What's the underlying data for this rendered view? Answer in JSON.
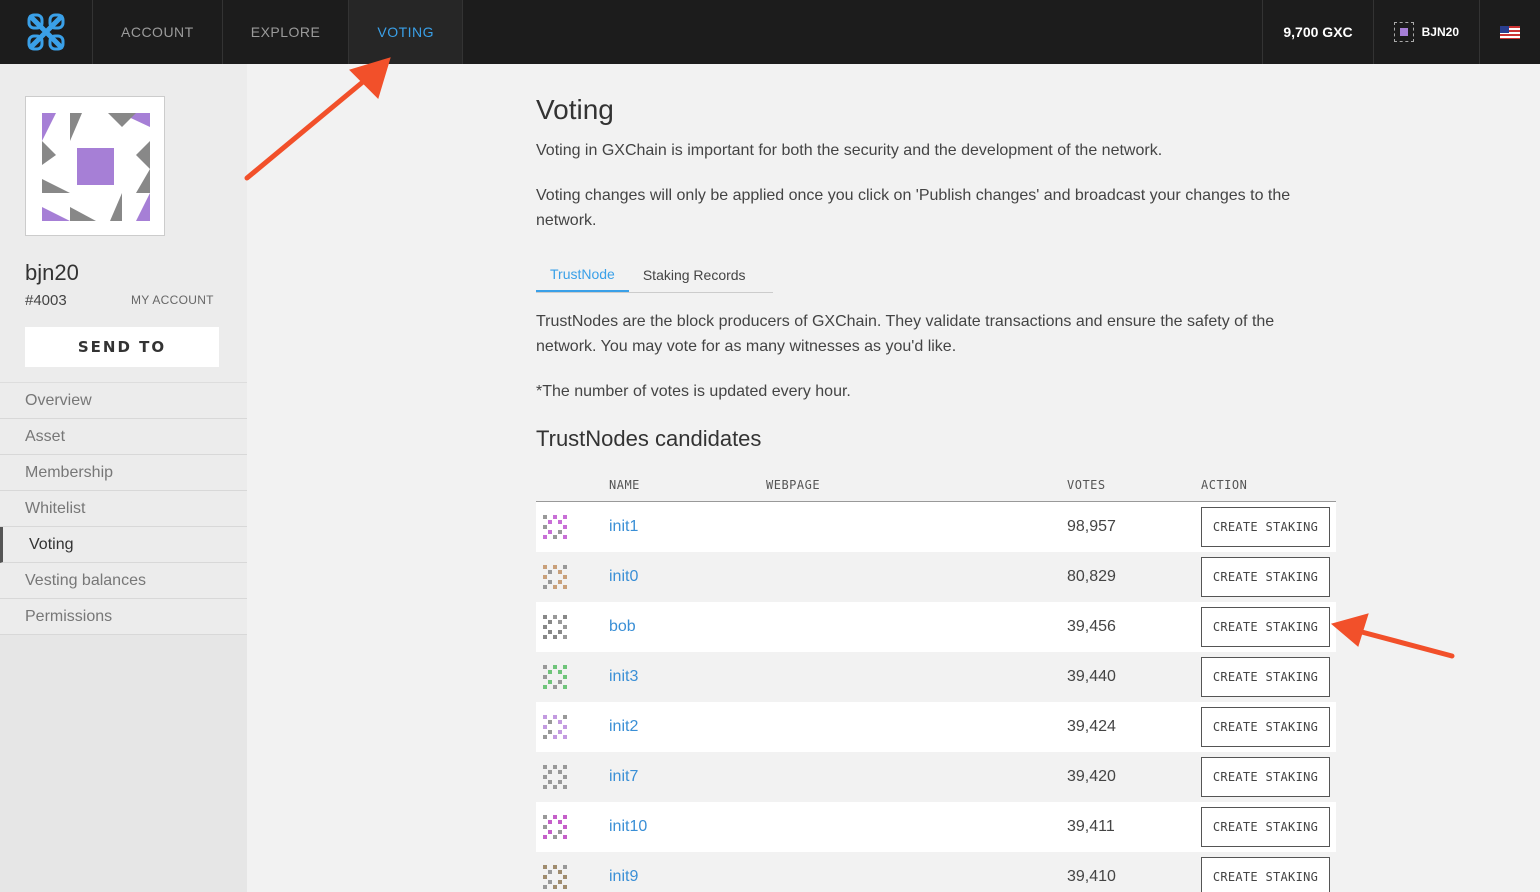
{
  "topbar": {
    "logo_icon": "gxchain-logo-icon",
    "nav": [
      {
        "label": "ACCOUNT",
        "active": false
      },
      {
        "label": "EXPLORE",
        "active": false
      },
      {
        "label": "VOTING",
        "active": true
      }
    ],
    "balance": "9,700 GXC",
    "account": "BJN20",
    "language_icon": "us-flag-icon"
  },
  "sidebar": {
    "account_name": "bjn20",
    "account_id": "#4003",
    "my_account_label": "MY ACCOUNT",
    "send_to_label": "SEND TO",
    "menu": [
      {
        "label": "Overview",
        "active": false
      },
      {
        "label": "Asset",
        "active": false
      },
      {
        "label": "Membership",
        "active": false
      },
      {
        "label": "Whitelist",
        "active": false
      },
      {
        "label": "Voting",
        "active": true
      },
      {
        "label": "Vesting balances",
        "active": false
      },
      {
        "label": "Permissions",
        "active": false
      }
    ]
  },
  "main": {
    "title": "Voting",
    "intro1": "Voting in GXChain is important for both the security and the development of the network.",
    "intro2": "Voting changes will only be applied once you click on 'Publish changes' and broadcast your changes to the network.",
    "tabs": [
      {
        "label": "TrustNode",
        "active": true
      },
      {
        "label": "Staking Records",
        "active": false
      }
    ],
    "desc1": "TrustNodes are the block producers of GXChain. They validate transactions and ensure the safety of the network. You may vote for as many witnesses as you'd like.",
    "desc2": "*The number of votes is updated every hour.",
    "section_title": "TrustNodes candidates",
    "table": {
      "headers": {
        "name": "NAME",
        "webpage": "WEBPAGE",
        "votes": "VOTES",
        "action": "ACTION"
      },
      "action_label": "CREATE STAKING",
      "rows": [
        {
          "name": "init1",
          "votes": "98,957",
          "color": "#c86fd6"
        },
        {
          "name": "init0",
          "votes": "80,829",
          "color": "#c9a07a"
        },
        {
          "name": "bob",
          "votes": "39,456",
          "color": "#888888"
        },
        {
          "name": "init3",
          "votes": "39,440",
          "color": "#6fc47a"
        },
        {
          "name": "init2",
          "votes": "39,424",
          "color": "#c39ae0"
        },
        {
          "name": "init7",
          "votes": "39,420",
          "color": "#999999"
        },
        {
          "name": "init10",
          "votes": "39,411",
          "color": "#c55fc9"
        },
        {
          "name": "init9",
          "votes": "39,410",
          "color": "#a08c6e"
        }
      ]
    }
  },
  "colors": {
    "accent": "#3aa0e8",
    "link": "#3a8fd6",
    "annotation": "#f2502a",
    "avatar_purple": "#a67fd6"
  }
}
